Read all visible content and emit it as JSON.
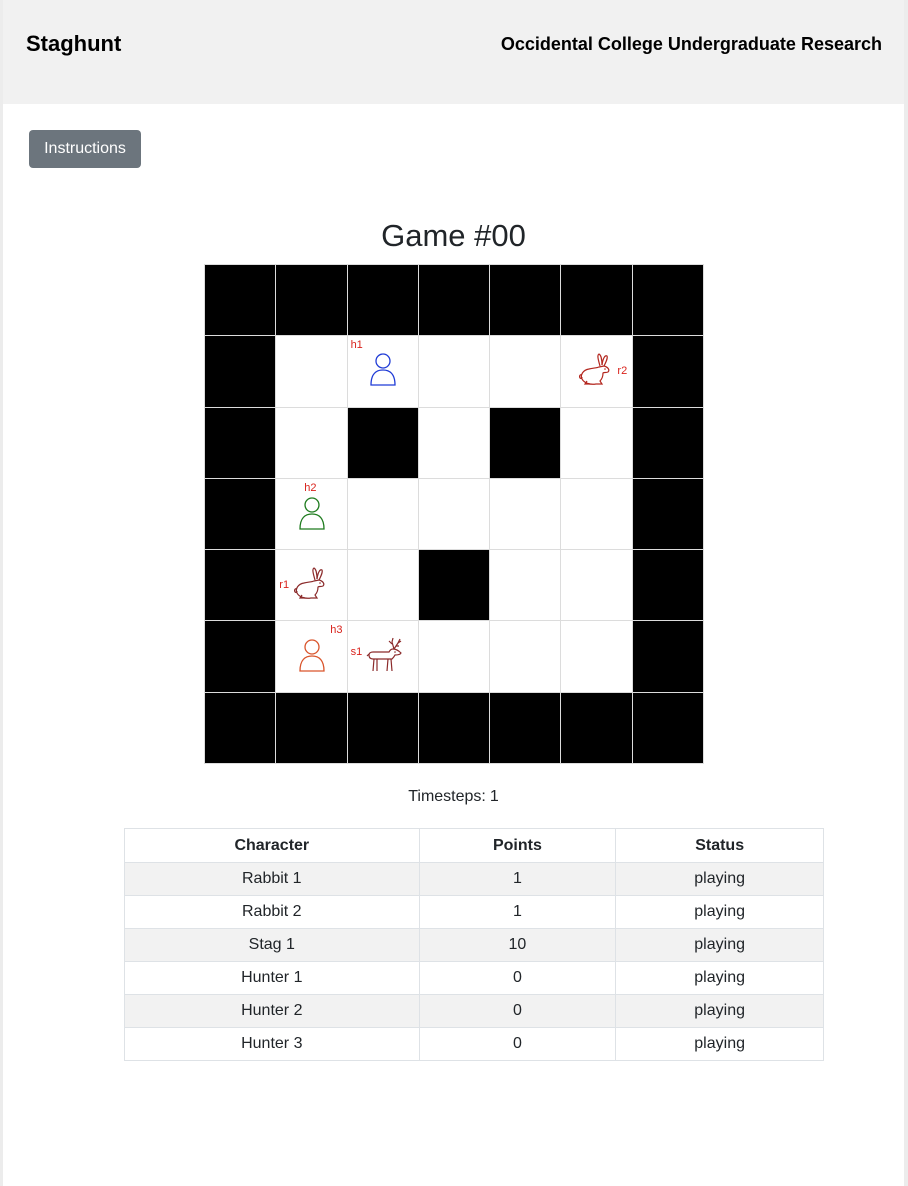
{
  "header": {
    "brand": "Staghunt",
    "org": "Occidental College Undergraduate Research"
  },
  "toolbar": {
    "instructions_label": "Instructions"
  },
  "game": {
    "title": "Game #00",
    "grid_size": 7,
    "walls": [
      [
        0,
        0
      ],
      [
        0,
        1
      ],
      [
        0,
        2
      ],
      [
        0,
        3
      ],
      [
        0,
        4
      ],
      [
        0,
        5
      ],
      [
        0,
        6
      ],
      [
        1,
        0
      ],
      [
        1,
        6
      ],
      [
        2,
        0
      ],
      [
        2,
        2
      ],
      [
        2,
        4
      ],
      [
        2,
        6
      ],
      [
        3,
        0
      ],
      [
        3,
        6
      ],
      [
        4,
        0
      ],
      [
        4,
        3
      ],
      [
        4,
        6
      ],
      [
        5,
        0
      ],
      [
        5,
        6
      ],
      [
        6,
        0
      ],
      [
        6,
        1
      ],
      [
        6,
        2
      ],
      [
        6,
        3
      ],
      [
        6,
        4
      ],
      [
        6,
        5
      ],
      [
        6,
        6
      ]
    ],
    "pieces": [
      {
        "id": "h1",
        "kind": "hunter",
        "row": 1,
        "col": 2,
        "color": "#1f3bd6",
        "icon": "hunter-icon"
      },
      {
        "id": "r2",
        "kind": "rabbit",
        "row": 1,
        "col": 5,
        "color": "#b3261e",
        "icon": "rabbit-icon"
      },
      {
        "id": "h2",
        "kind": "hunter",
        "row": 3,
        "col": 1,
        "color": "#1e7b1e",
        "icon": "hunter-icon"
      },
      {
        "id": "r1",
        "kind": "rabbit",
        "row": 4,
        "col": 1,
        "color": "#8b2a2a",
        "icon": "rabbit-icon"
      },
      {
        "id": "h3",
        "kind": "hunter",
        "row": 5,
        "col": 1,
        "color": "#d9542b",
        "icon": "hunter-icon"
      },
      {
        "id": "s1",
        "kind": "stag",
        "row": 5,
        "col": 2,
        "color": "#8b2a2a",
        "icon": "stag-icon"
      }
    ],
    "label_color": "#d9231c",
    "timesteps_label": "Timesteps:",
    "timesteps_value": "1"
  },
  "scores": {
    "headers": [
      "Character",
      "Points",
      "Status"
    ],
    "rows": [
      [
        "Rabbit 1",
        "1",
        "playing"
      ],
      [
        "Rabbit 2",
        "1",
        "playing"
      ],
      [
        "Stag 1",
        "10",
        "playing"
      ],
      [
        "Hunter 1",
        "0",
        "playing"
      ],
      [
        "Hunter 2",
        "0",
        "playing"
      ],
      [
        "Hunter 3",
        "0",
        "playing"
      ]
    ]
  }
}
